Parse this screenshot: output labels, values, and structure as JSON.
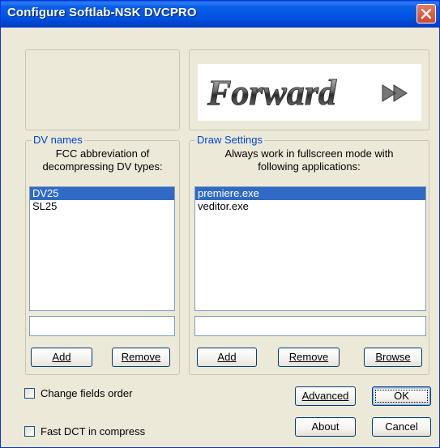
{
  "window": {
    "title": "Configure Softlab-NSK DVCPRO"
  },
  "logo": {
    "text": "Forward"
  },
  "dv_names": {
    "legend": "DV names",
    "caption_line1": "FCC abbreviation of",
    "caption_line2": "decompressing DV types:",
    "items": [
      {
        "label": "DV25",
        "selected": true
      },
      {
        "label": "SL25",
        "selected": false
      }
    ],
    "input_value": "",
    "add_label": "Add",
    "remove_label": "Remove"
  },
  "draw_settings": {
    "legend": "Draw Settings",
    "caption_line1": "Always work in fullscreen mode with",
    "caption_line2": "following applications:",
    "items": [
      {
        "label": "premiere.exe",
        "selected": true
      },
      {
        "label": "veditor.exe",
        "selected": false
      }
    ],
    "input_value": "",
    "add_label": "Add",
    "remove_label": "Remove",
    "browse_label": "Browse"
  },
  "options": {
    "change_fields_order": {
      "label": "Change fields order",
      "checked": false
    },
    "fast_dct": {
      "label": "Fast DCT in compress",
      "checked": false
    }
  },
  "buttons": {
    "advanced": "Advanced",
    "ok": "OK",
    "about": "About",
    "cancel": "Cancel"
  },
  "colors": {
    "titlebar": "#0054e3",
    "selection": "#316ac5",
    "legend_text": "#0046d5",
    "dialog_bg": "#ece9d8"
  }
}
